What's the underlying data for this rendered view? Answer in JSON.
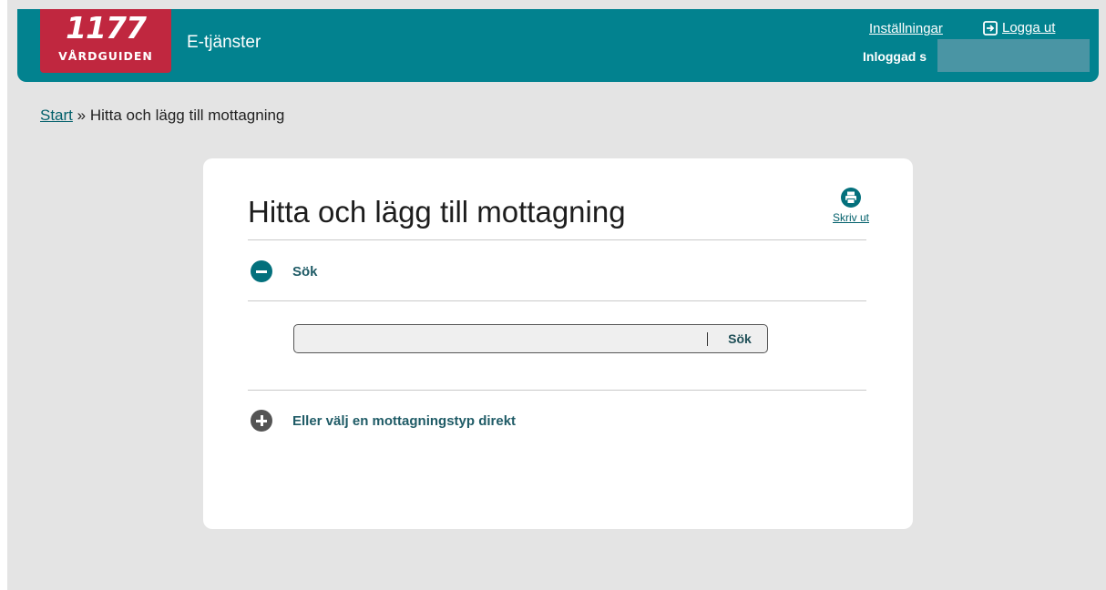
{
  "header": {
    "logo_number": "1177",
    "logo_text": "VÅRDGUIDEN",
    "service_title": "E-tjänster",
    "settings_label": "Inställningar",
    "logout_label": "Logga ut",
    "logged_in_label": "Inloggad s"
  },
  "breadcrumb": {
    "start_label": "Start",
    "separator": " » ",
    "current": "Hitta och lägg till mottagning"
  },
  "card": {
    "title": "Hitta och lägg till mottagning",
    "print_label": "Skriv ut",
    "search_section": {
      "label": "Sök",
      "input_value": "",
      "button_label": "Sök",
      "expanded": true
    },
    "type_section": {
      "label": "Eller välj en mottagningstyp direkt",
      "expanded": false
    }
  },
  "colors": {
    "header_bg": "#02828f",
    "logo_bg": "#c0273f",
    "page_bg": "#e4e4e4",
    "link": "#02606b",
    "minus_icon": "#03707c",
    "plus_icon": "#545454"
  },
  "icons": {
    "logout": "logout-arrow-icon",
    "print": "printer-icon",
    "collapse": "minus-circle-icon",
    "expand": "plus-circle-icon"
  }
}
